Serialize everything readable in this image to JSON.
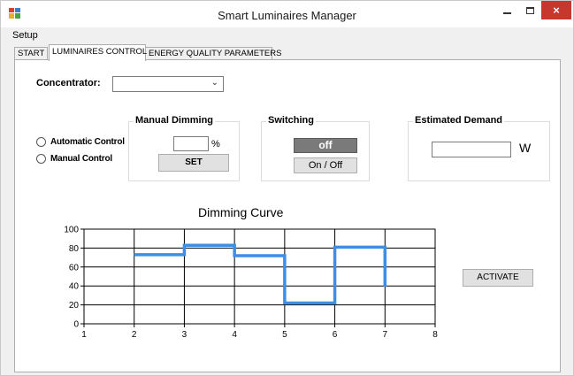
{
  "window": {
    "title": "Smart Luminaires Manager",
    "close_glyph": "×"
  },
  "menu": {
    "setup": "Setup"
  },
  "tabs": [
    "START",
    "LUMINAIRES CONTROL",
    "ENERGY QUALITY PARAMETERS"
  ],
  "control": {
    "concentrator_label": "Concentrator:",
    "concentrator_value": "",
    "chevron": "⌄",
    "radio_automatic": "Automatic Control",
    "radio_manual": "Manual Control",
    "manual_dimming": {
      "title": "Manual Dimming",
      "value": "",
      "unit": "%",
      "set_label": "SET"
    },
    "switching": {
      "title": "Switching",
      "state": "off",
      "toggle_label": "On / Off"
    },
    "estimated_demand": {
      "title": "Estimated Demand",
      "value": "",
      "unit": "W"
    },
    "activate_label": "ACTIVATE"
  },
  "chart_data": {
    "type": "line",
    "title": "Dimming Curve",
    "xlabel": "",
    "ylabel": "",
    "xlim": [
      1,
      8
    ],
    "ylim": [
      0,
      100
    ],
    "x_ticks": [
      1,
      2,
      3,
      4,
      5,
      6,
      7,
      8
    ],
    "y_ticks": [
      0,
      20,
      40,
      60,
      80,
      100
    ],
    "grid": true,
    "step": true,
    "color": "#3d8ee6",
    "points": [
      {
        "x": 2,
        "y": 73
      },
      {
        "x": 3,
        "y": 73
      },
      {
        "x": 3,
        "y": 83
      },
      {
        "x": 4,
        "y": 83
      },
      {
        "x": 4,
        "y": 72
      },
      {
        "x": 5,
        "y": 72
      },
      {
        "x": 5,
        "y": 22
      },
      {
        "x": 6,
        "y": 22
      },
      {
        "x": 6,
        "y": 81
      },
      {
        "x": 7,
        "y": 81
      },
      {
        "x": 7,
        "y": 39
      }
    ]
  }
}
